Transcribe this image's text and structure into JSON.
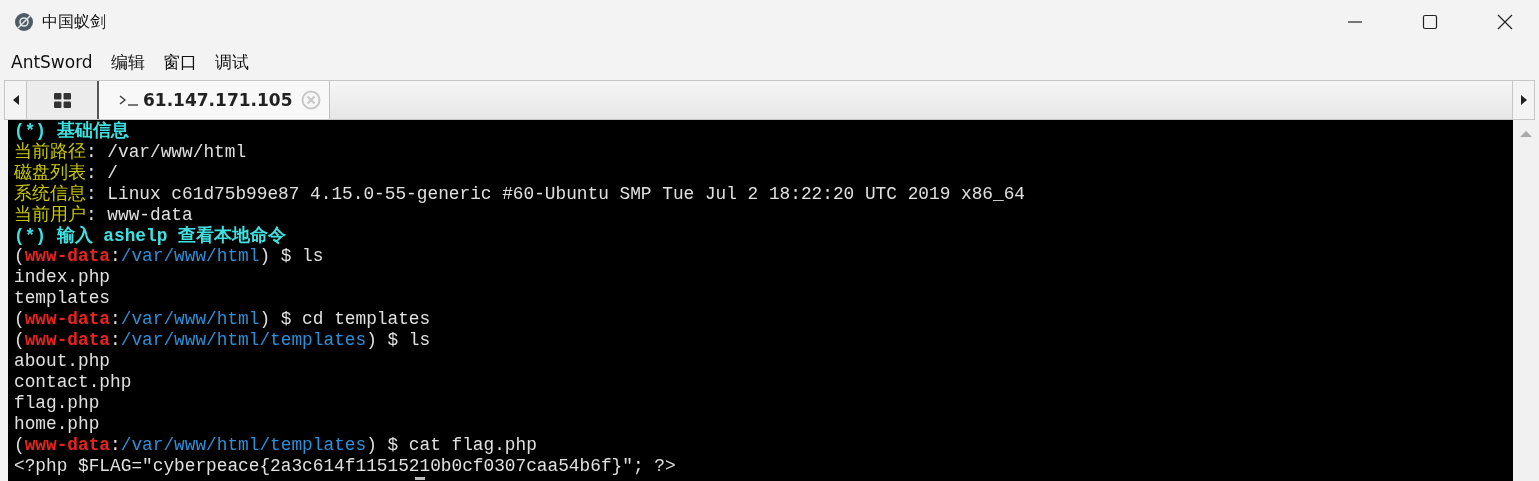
{
  "window": {
    "title": "中国蚁剑"
  },
  "menu": [
    "AntSword",
    "编辑",
    "窗口",
    "调试"
  ],
  "tabs": [
    {
      "kind": "home",
      "selected": false
    },
    {
      "kind": "terminal",
      "label": "61.147.171.105",
      "selected": true
    }
  ],
  "terminal": {
    "lines": [
      {
        "bold": true,
        "segments": [
          {
            "kind": "heading",
            "text": "(*) 基础信息"
          }
        ]
      },
      {
        "bold": false,
        "segments": [
          {
            "kind": "label",
            "text": "当前路径"
          },
          {
            "kind": "text",
            "text": ": /var/www/html"
          }
        ]
      },
      {
        "bold": false,
        "segments": [
          {
            "kind": "label",
            "text": "磁盘列表"
          },
          {
            "kind": "text",
            "text": ": /"
          }
        ]
      },
      {
        "bold": false,
        "segments": [
          {
            "kind": "label",
            "text": "系统信息"
          },
          {
            "kind": "text",
            "text": ": Linux c61d75b99e87 4.15.0-55-generic #60-Ubuntu SMP Tue Jul 2 18:22:20 UTC 2019 x86_64"
          }
        ]
      },
      {
        "bold": false,
        "segments": [
          {
            "kind": "label",
            "text": "当前用户"
          },
          {
            "kind": "text",
            "text": ": www-data"
          }
        ]
      },
      {
        "bold": true,
        "segments": [
          {
            "kind": "heading",
            "text": "(*) 输入 ashelp 查看本地命令"
          }
        ]
      },
      {
        "bold": false,
        "segments": [
          {
            "kind": "text",
            "text": "("
          },
          {
            "kind": "user",
            "text": "www-data"
          },
          {
            "kind": "text",
            "text": ":"
          },
          {
            "kind": "path",
            "text": "/var/www/html"
          },
          {
            "kind": "text",
            "text": ") $ ls"
          }
        ]
      },
      {
        "bold": false,
        "segments": [
          {
            "kind": "text",
            "text": "index.php"
          }
        ]
      },
      {
        "bold": false,
        "segments": [
          {
            "kind": "text",
            "text": "templates"
          }
        ]
      },
      {
        "bold": false,
        "segments": [
          {
            "kind": "text",
            "text": "("
          },
          {
            "kind": "user",
            "text": "www-data"
          },
          {
            "kind": "text",
            "text": ":"
          },
          {
            "kind": "path",
            "text": "/var/www/html"
          },
          {
            "kind": "text",
            "text": ") $ cd templates"
          }
        ]
      },
      {
        "bold": false,
        "segments": [
          {
            "kind": "text",
            "text": "("
          },
          {
            "kind": "user",
            "text": "www-data"
          },
          {
            "kind": "text",
            "text": ":"
          },
          {
            "kind": "path",
            "text": "/var/www/html/templates"
          },
          {
            "kind": "text",
            "text": ") $ ls"
          }
        ]
      },
      {
        "bold": false,
        "segments": [
          {
            "kind": "text",
            "text": "about.php"
          }
        ]
      },
      {
        "bold": false,
        "segments": [
          {
            "kind": "text",
            "text": "contact.php"
          }
        ]
      },
      {
        "bold": false,
        "segments": [
          {
            "kind": "text",
            "text": "flag.php"
          }
        ]
      },
      {
        "bold": false,
        "segments": [
          {
            "kind": "text",
            "text": "home.php"
          }
        ]
      },
      {
        "bold": false,
        "segments": [
          {
            "kind": "text",
            "text": "("
          },
          {
            "kind": "user",
            "text": "www-data"
          },
          {
            "kind": "text",
            "text": ":"
          },
          {
            "kind": "path",
            "text": "/var/www/html/templates"
          },
          {
            "kind": "text",
            "text": ") $ cat flag.php"
          }
        ]
      },
      {
        "bold": false,
        "segments": [
          {
            "kind": "text",
            "text": "<?php $FLAG=\"cyberpeace{2a3c614f11515210b0cf0307caa54b6f}\"; ?>"
          }
        ]
      }
    ]
  }
}
